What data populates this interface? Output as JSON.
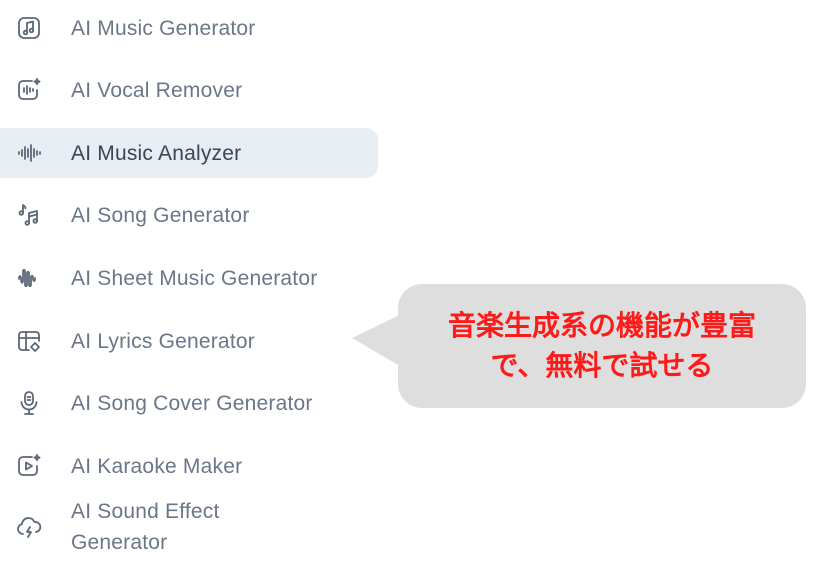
{
  "menu": {
    "items": [
      {
        "label": "AI Music Generator",
        "icon": "music-note-icon"
      },
      {
        "label": "AI Vocal Remover",
        "icon": "vocal-remover-icon"
      },
      {
        "label": "AI Music Analyzer",
        "icon": "waveform-icon"
      },
      {
        "label": "AI Song Generator",
        "icon": "song-notes-icon"
      },
      {
        "label": "AI Sheet Music Generator",
        "icon": "sheet-wave-icon"
      },
      {
        "label": "AI Lyrics Generator",
        "icon": "lyrics-grid-icon"
      },
      {
        "label": "AI Song Cover Generator",
        "icon": "microphone-icon"
      },
      {
        "label": "AI Karaoke Maker",
        "icon": "karaoke-play-icon"
      },
      {
        "label": "AI Sound Effect\nGenerator",
        "icon": "sound-cloud-icon"
      }
    ],
    "active_index": 2
  },
  "callout": {
    "line1": "音楽生成系の機能が豊富",
    "line2": "で、無料で試せる",
    "background": "#dedede",
    "text_color": "#ff1a1a"
  }
}
